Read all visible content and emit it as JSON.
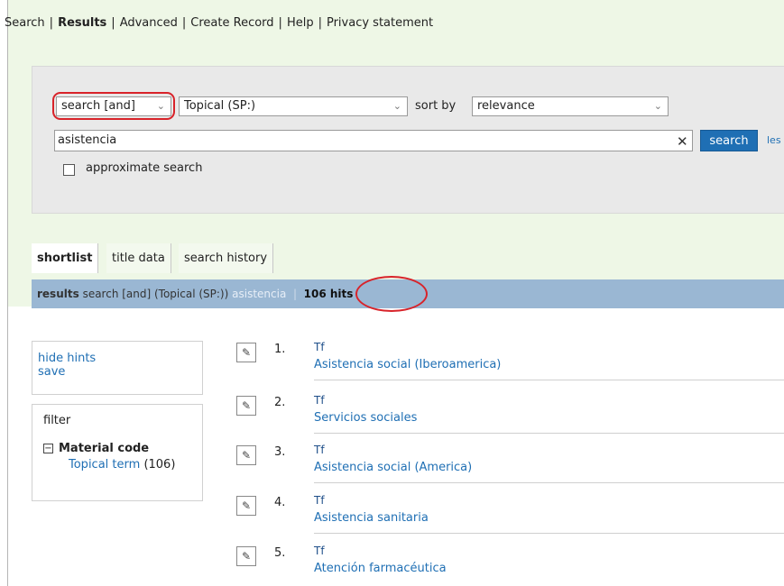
{
  "nav": {
    "items": [
      "Search",
      "Results",
      "Advanced",
      "Create Record",
      "Help",
      "Privacy statement"
    ],
    "active": "Results"
  },
  "search": {
    "mode": "search [and]",
    "index": "Topical (SP:)",
    "sort_label": "sort by",
    "sort_value": "relevance",
    "query": "asistencia",
    "button": "search",
    "cut_link": "les",
    "approx_label": "approximate search"
  },
  "tabs": [
    "shortlist",
    "title data",
    "search history"
  ],
  "results_bar": {
    "label": "results",
    "query_desc": "search [and]  (Topical (SP:))",
    "term": "asistencia",
    "hits": "106 hits"
  },
  "hints": {
    "hide": "hide hints",
    "save": "save"
  },
  "filter": {
    "title": "filter",
    "group": "Material code",
    "item": "Topical term",
    "count": "(106)"
  },
  "records": [
    {
      "num": "1.",
      "type": "Tf",
      "title": "Asistencia social (Iberoamerica)"
    },
    {
      "num": "2.",
      "type": "Tf",
      "title": "Servicios sociales"
    },
    {
      "num": "3.",
      "type": "Tf",
      "title": "Asistencia social (America)"
    },
    {
      "num": "4.",
      "type": "Tf",
      "title": "Asistencia sanitaria"
    },
    {
      "num": "5.",
      "type": "Tf",
      "title": "Atención farmacéutica"
    }
  ],
  "colors": {
    "accent": "#1f6fb4",
    "highlight": "#d8232a",
    "band": "#eef7e6",
    "results_bar": "#9ab7d3"
  }
}
